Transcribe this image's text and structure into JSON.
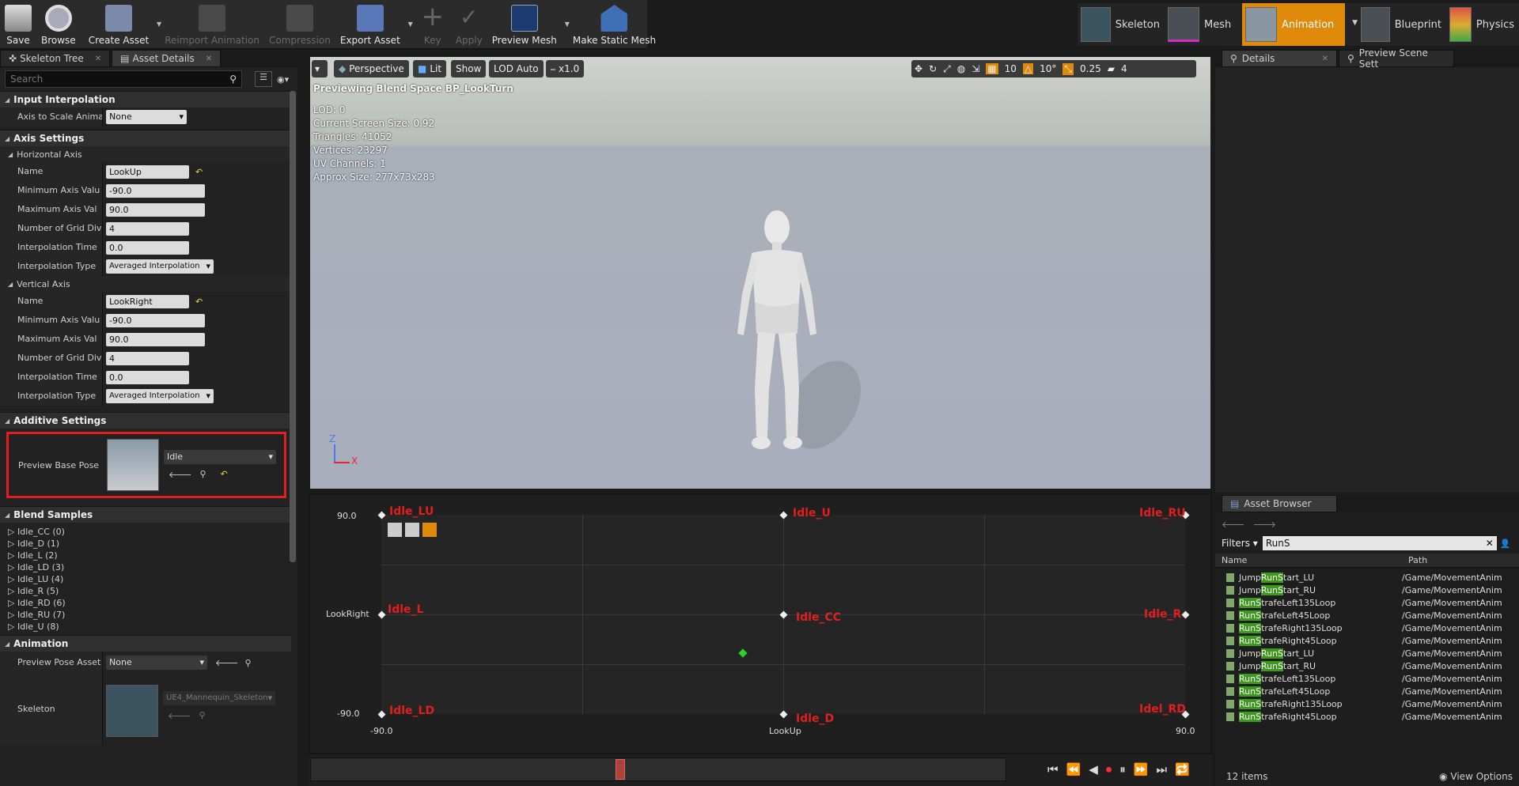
{
  "toolbar": {
    "items": [
      {
        "label": "Save",
        "icon": "save-icon",
        "enabled": true
      },
      {
        "label": "Browse",
        "icon": "browse-icon",
        "enabled": true
      },
      {
        "label": "Create Asset",
        "icon": "create-asset-icon",
        "enabled": true
      },
      {
        "label": "Reimport Animation",
        "icon": "reimport-icon",
        "enabled": false
      },
      {
        "label": "Compression",
        "icon": "compression-icon",
        "enabled": false
      },
      {
        "label": "Export Asset",
        "icon": "export-icon",
        "enabled": true
      },
      {
        "label": "Key",
        "icon": "key-icon",
        "enabled": false
      },
      {
        "label": "Apply",
        "icon": "apply-icon",
        "enabled": false
      },
      {
        "label": "Preview Mesh",
        "icon": "preview-mesh-icon",
        "enabled": true
      },
      {
        "label": "Make Static Mesh",
        "icon": "static-mesh-icon",
        "enabled": true
      }
    ]
  },
  "modes": {
    "skeleton": "Skeleton",
    "mesh": "Mesh",
    "animation": "Animation",
    "blueprint": "Blueprint",
    "physics": "Physics"
  },
  "left": {
    "tabs": {
      "skeleton_tree": "Skeleton Tree",
      "asset_details": "Asset Details"
    },
    "search_placeholder": "Search",
    "input_interpolation": {
      "title": "Input Interpolation",
      "axis_to_scale_label": "Axis to Scale Animati",
      "axis_to_scale_value": "None"
    },
    "axis_settings": {
      "title": "Axis Settings",
      "horizontal": {
        "title": "Horizontal Axis",
        "name_label": "Name",
        "name": "LookUp",
        "min_label": "Minimum Axis Valu",
        "min": "-90.0",
        "max_label": "Maximum Axis Val",
        "max": "90.0",
        "grid_label": "Number of Grid Divi",
        "grid": "4",
        "interp_time_label": "Interpolation Time",
        "interp_time": "0.0",
        "interp_type_label": "Interpolation Type",
        "interp_type": "Averaged Interpolation"
      },
      "vertical": {
        "title": "Vertical Axis",
        "name_label": "Name",
        "name": "LookRight",
        "min_label": "Minimum Axis Valu",
        "min": "-90.0",
        "max_label": "Maximum Axis Val",
        "max": "90.0",
        "grid_label": "Number of Grid Divi",
        "grid": "4",
        "interp_time_label": "Interpolation Time",
        "interp_time": "0.0",
        "interp_type_label": "Interpolation Type",
        "interp_type": "Averaged Interpolation"
      }
    },
    "additive": {
      "title": "Additive Settings",
      "preview_base_pose_label": "Preview Base Pose",
      "preview_base_pose": "Idle"
    },
    "blend_samples": {
      "title": "Blend Samples",
      "items": [
        "Idle_CC (0)",
        "Idle_D (1)",
        "Idle_L (2)",
        "Idle_LD (3)",
        "Idle_LU (4)",
        "Idle_R (5)",
        "Idle_RD (6)",
        "Idle_RU (7)",
        "Idle_U (8)"
      ]
    },
    "animation": {
      "title": "Animation",
      "preview_pose_asset_label": "Preview Pose Asset",
      "preview_pose_asset": "None",
      "skeleton_label": "Skeleton",
      "skeleton": "UE4_Mannequin_Skeleton"
    }
  },
  "viewport": {
    "perspective": "Perspective",
    "lit": "Lit",
    "show": "Show",
    "lod": "LOD Auto",
    "speed": "x1.0",
    "grid_snap": "10",
    "rot_snap": "10°",
    "scale_snap": "0.25",
    "cam_speed": "4",
    "preview_title": "Previewing Blend Space BP_LookTurn",
    "stats": [
      "LOD: 0",
      "Current Screen Size: 0.92",
      "Triangles: 41052",
      "Vertices: 23297",
      "UV Channels: 1",
      "Approx Size: 277x73x283"
    ],
    "axis_z": "Z",
    "axis_x": "X"
  },
  "blendspace": {
    "y_max": "90.0",
    "y_min": "-90.0",
    "y_axis": "LookRight",
    "x_min": "-90.0",
    "x_max": "90.0",
    "x_axis": "LookUp",
    "samples": [
      "Idle_LU",
      "Idle_U",
      "Idle_RU",
      "Idle_L",
      "Idle_CC",
      "Idle_R",
      "Idle_LD",
      "Idle_D",
      "Idel_RD"
    ]
  },
  "right": {
    "details_tab": "Details",
    "preview_tab": "Preview Scene Sett"
  },
  "asset_browser": {
    "tab": "Asset Browser",
    "filters": "Filters",
    "search_value": "RunS",
    "col_name": "Name",
    "col_path": "Path",
    "rows": [
      {
        "pre": "Jump",
        "hl": "RunS",
        "post": "tart_LU",
        "path": "/Game/MovementAnim"
      },
      {
        "pre": "Jump",
        "hl": "RunS",
        "post": "tart_RU",
        "path": "/Game/MovementAnim"
      },
      {
        "pre": "",
        "hl": "RunS",
        "post": "trafeLeft135Loop",
        "path": "/Game/MovementAnim"
      },
      {
        "pre": "",
        "hl": "RunS",
        "post": "trafeLeft45Loop",
        "path": "/Game/MovementAnim"
      },
      {
        "pre": "",
        "hl": "RunS",
        "post": "trafeRight135Loop",
        "path": "/Game/MovementAnim"
      },
      {
        "pre": "",
        "hl": "RunS",
        "post": "trafeRight45Loop",
        "path": "/Game/MovementAnim"
      },
      {
        "pre": "Jump",
        "hl": "RunS",
        "post": "tart_LU",
        "path": "/Game/MovementAnim"
      },
      {
        "pre": "Jump",
        "hl": "RunS",
        "post": "tart_RU",
        "path": "/Game/MovementAnim"
      },
      {
        "pre": "",
        "hl": "RunS",
        "post": "trafeLeft135Loop",
        "path": "/Game/MovementAnim"
      },
      {
        "pre": "",
        "hl": "RunS",
        "post": "trafeLeft45Loop",
        "path": "/Game/MovementAnim"
      },
      {
        "pre": "",
        "hl": "RunS",
        "post": "trafeRight135Loop",
        "path": "/Game/MovementAnim"
      },
      {
        "pre": "",
        "hl": "RunS",
        "post": "trafeRight45Loop",
        "path": "/Game/MovementAnim"
      }
    ],
    "count": "12 items",
    "view_options": "View Options"
  },
  "colors": {
    "accent": "#e08a0b",
    "highlight": "#3d9a1e",
    "label_red": "#e21e1e",
    "outline_red": "#e21e1e"
  }
}
